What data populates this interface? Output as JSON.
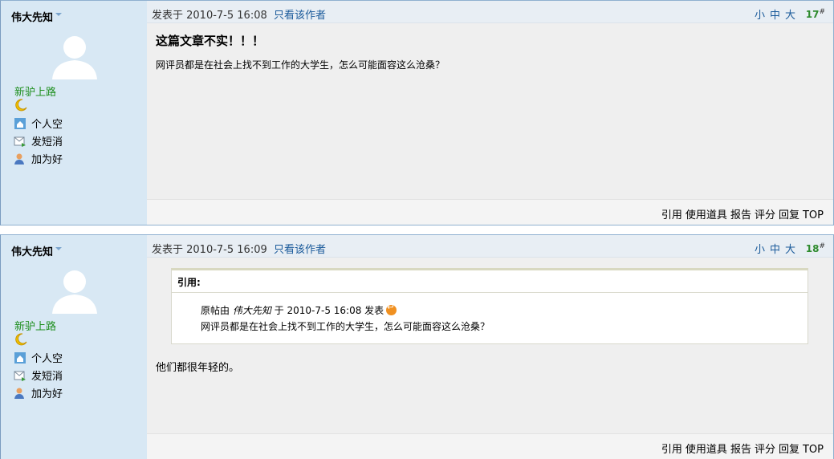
{
  "posts": [
    {
      "author": "伟大先知",
      "rank": "新驴上路",
      "links": [
        "个人空",
        "发短消",
        "加为好"
      ],
      "posted": "发表于 2010-7-5 16:08",
      "only_author": "只看该作者",
      "font_sizes": [
        "小",
        "中",
        "大"
      ],
      "floor": "17",
      "floor_mark": "#",
      "title": "这篇文章不实！！！",
      "body": "网评员都是在社会上找不到工作的大学生，怎么可能面容这么沧桑？",
      "actions": [
        "引用",
        "使用道具",
        "报告",
        "评分",
        "回复",
        "TOP"
      ]
    },
    {
      "author": "伟大先知",
      "rank": "新驴上路",
      "links": [
        "个人空",
        "发短消",
        "加为好"
      ],
      "posted": "发表于 2010-7-5 16:09",
      "only_author": "只看该作者",
      "font_sizes": [
        "小",
        "中",
        "大"
      ],
      "floor": "18",
      "floor_mark": "#",
      "quote": {
        "label": "引用:",
        "origin_prefix": "原帖由",
        "origin_author": "伟大先知",
        "origin_suffix": "于 2010-7-5 16:08 发表",
        "text": "网评员都是在社会上找不到工作的大学生，怎么可能面容这么沧桑？"
      },
      "body": "他们都很年轻的。",
      "actions": [
        "引用",
        "使用道具",
        "报告",
        "评分",
        "回复",
        "TOP"
      ]
    }
  ],
  "icons": {
    "avatar": "avatar-silhouette",
    "rank": "moon-icon",
    "links": [
      "home-icon",
      "message-icon",
      "add-friend-icon"
    ]
  },
  "colors": {
    "sidebar": "#d8e8f4",
    "link": "#1a5a9a",
    "rank": "#1f8f1f",
    "floor": "#2e8b2e"
  }
}
